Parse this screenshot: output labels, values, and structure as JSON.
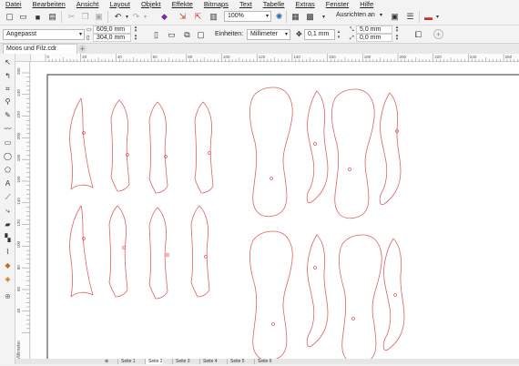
{
  "menu": [
    "Datei",
    "Bearbeiten",
    "Ansicht",
    "Layout",
    "Objekt",
    "Effekte",
    "Bitmaps",
    "Text",
    "Tabelle",
    "Extras",
    "Fenster",
    "Hilfe"
  ],
  "toolbar": {
    "zoom": "100%",
    "snap": "Ausrichten an"
  },
  "property_bar": {
    "preset": "Angepasst",
    "width": "609,0 mm",
    "height": "304,0 mm",
    "units_label": "Einheiten:",
    "units": "Millimeter",
    "nudge": "0,1 mm",
    "dup_x": "5,0 mm",
    "dup_y": "0,0 mm"
  },
  "document_tab": "Moos und Filz.cdr",
  "hruler_ticks": [
    "0",
    "20",
    "40",
    "60",
    "80",
    "100",
    "120",
    "140",
    "160",
    "180",
    "200",
    "220",
    "240",
    "260",
    "280"
  ],
  "vruler_ticks": [
    "260",
    "240",
    "220",
    "200",
    "180",
    "160",
    "140",
    "120",
    "100",
    "80",
    "60",
    "40",
    "20"
  ],
  "vruler_unit": "Millimeter",
  "pages": [
    "Seite 1",
    "Seite 2",
    "Seite 3",
    "Seite 4",
    "Seite 5",
    "Seite 6"
  ],
  "colors": {
    "outline": "#e06060",
    "page_border": "#333333",
    "canvas": "#ffffff"
  }
}
